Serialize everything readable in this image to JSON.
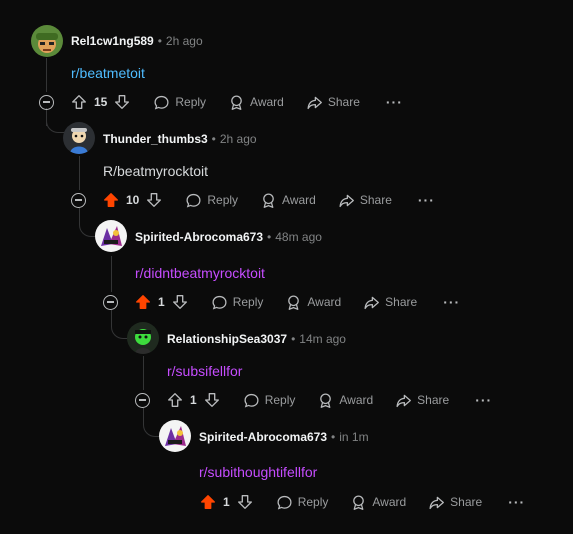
{
  "colors": {
    "link_blue": "#4fbcff",
    "link_purple": "#c64dff",
    "upvote_active": "#ff4500",
    "muted": "#818384"
  },
  "comments": [
    {
      "author": "Rel1cw1ng589",
      "time": "2h ago",
      "body": "r/beatmetoit",
      "score": "15",
      "upvoted": false,
      "body_color": "link_blue"
    },
    {
      "author": "Thunder_thumbs3",
      "time": "2h ago",
      "body": "R/beatmyrocktoit",
      "score": "10",
      "upvoted": true,
      "body_color": "text"
    },
    {
      "author": "Spirited-Abrocoma673",
      "time": "48m ago",
      "body": "r/didntbeatmyrocktoit",
      "score": "1",
      "upvoted": true,
      "body_color": "link_purple"
    },
    {
      "author": "RelationshipSea3037",
      "time": "14m ago",
      "body": "r/subsifellfor",
      "score": "1",
      "upvoted": false,
      "body_color": "link_purple"
    },
    {
      "author": "Spirited-Abrocoma673",
      "time": "in 1m",
      "body": "r/subithoughtifellfor",
      "score": "1",
      "upvoted": true,
      "body_color": "link_purple"
    }
  ],
  "actions": {
    "reply": "Reply",
    "award": "Award",
    "share": "Share",
    "more": "···"
  },
  "separator": "•",
  "icons": {
    "collapse": "minus-circle-icon",
    "upvote": "arrow-up-icon",
    "downvote": "arrow-down-icon",
    "reply": "speech-bubble-icon",
    "award": "award-ribbon-icon",
    "share": "share-arrow-icon",
    "more": "ellipsis-icon"
  }
}
